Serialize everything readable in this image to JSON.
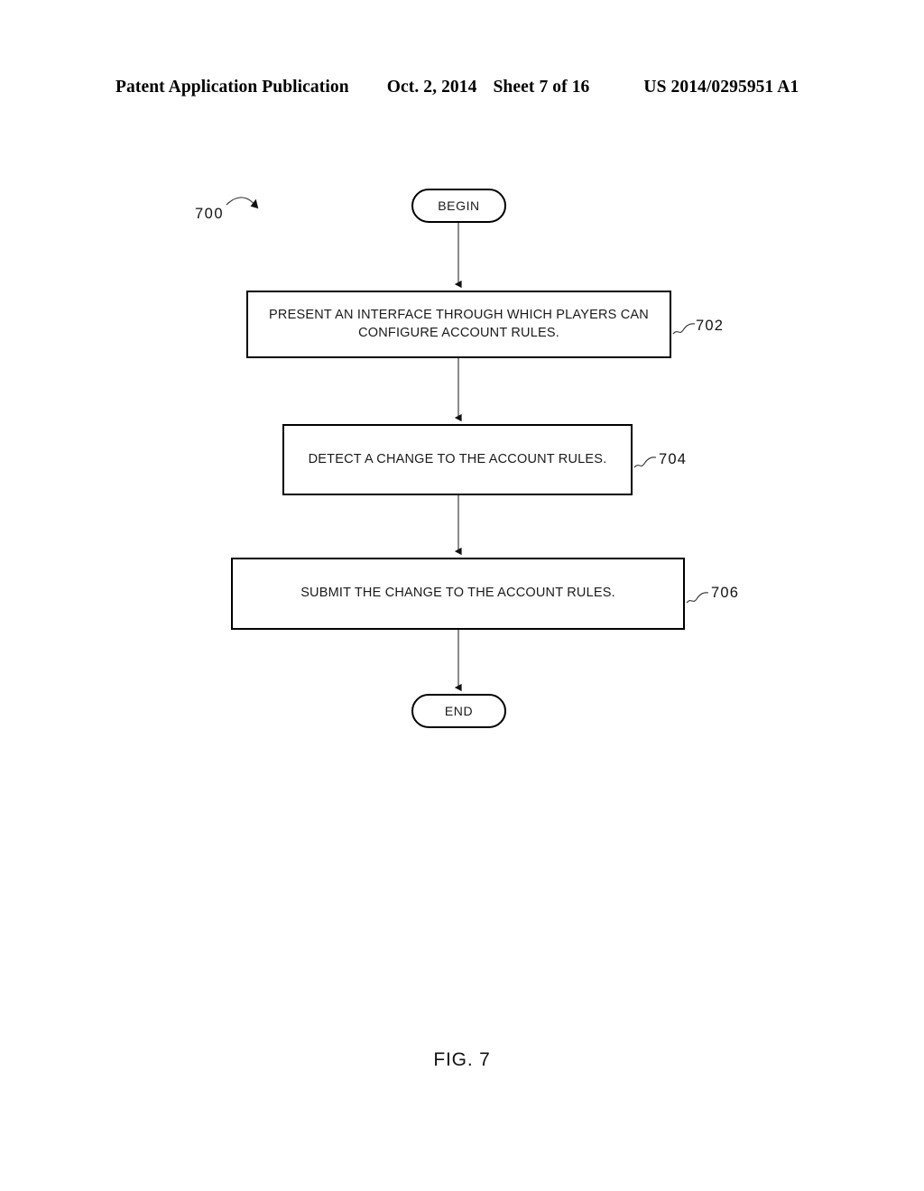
{
  "header": {
    "publication": "Patent Application Publication",
    "date": "Oct. 2, 2014",
    "sheet": "Sheet 7 of 16",
    "number": "US 2014/0295951 A1"
  },
  "figure": {
    "caption": "FIG. 7",
    "diagram_ref": "700",
    "type": "flowchart",
    "nodes": [
      {
        "id": "begin",
        "ref": "",
        "shape": "terminal",
        "text": "BEGIN"
      },
      {
        "id": "step702",
        "ref": "702",
        "shape": "process",
        "text": "PRESENT AN  INTERFACE THROUGH WHICH PLAYERS CAN CONFIGURE ACCOUNT RULES."
      },
      {
        "id": "step704",
        "ref": "704",
        "shape": "process",
        "text": "DETECT A CHANGE TO THE ACCOUNT RULES."
      },
      {
        "id": "step706",
        "ref": "706",
        "shape": "process",
        "text": "SUBMIT THE CHANGE TO THE ACCOUNT RULES."
      },
      {
        "id": "end",
        "ref": "",
        "shape": "terminal",
        "text": "END"
      }
    ],
    "edges": [
      {
        "from": "begin",
        "to": "step702"
      },
      {
        "from": "step702",
        "to": "step704"
      },
      {
        "from": "step704",
        "to": "step706"
      },
      {
        "from": "step706",
        "to": "end"
      }
    ]
  },
  "colors": {
    "ink": "#000000",
    "paper": "#ffffff",
    "connector": "#2b2b2b"
  }
}
